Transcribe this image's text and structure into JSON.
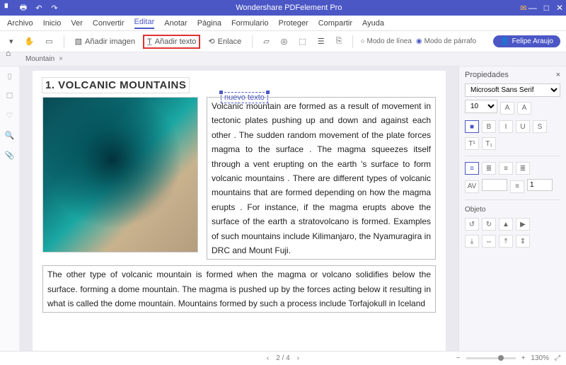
{
  "title": "Wondershare PDFelement Pro",
  "menu": {
    "items": [
      "Archivo",
      "Inicio",
      "Ver",
      "Convertir",
      "Editar",
      "Anotar",
      "Página",
      "Formulario",
      "Proteger",
      "Compartir",
      "Ayuda"
    ],
    "activeIndex": 4
  },
  "toolbar": {
    "addImage": "Añadir imagen",
    "addText": "Añadir texto",
    "link": "Enlace",
    "lineMode": "Modo de línea",
    "paraMode": "Modo de párrafo"
  },
  "user": "Felipe Araujo",
  "tab": {
    "name": "Mountain"
  },
  "doc": {
    "heading": "1. VOLCANIC MOUNTAINS",
    "newText": "nuevo texto",
    "col": "Volcanic mountain are formed as a result of movement in tectonic plates pushing up and down and against each other . The sudden random movement of the plate forces magma to the surface . The magma squeezes itself through a vent erupting on the earth 's surface to form volcanic mountains . There are different types of volcanic mountains that are formed depending on how the magma erupts . For instance, if the magma erupts above the surface of the earth a stratovolcano is formed. Examples of such mountains include Kilimanjaro, the Nyamuragira in DRC and Mount Fuji.",
    "full": "The other type of volcanic mountain is formed when the magma or volcano solidifies below the surface. forming a dome mountain. The magma is pushed up by the forces acting below it resulting in what is called the dome mountain. Mountains formed by such a process include Torfajokull in Iceland"
  },
  "props": {
    "title": "Propiedades",
    "font": "Microsoft Sans Serif",
    "size": "10",
    "B": "B",
    "I": "I",
    "U": "U",
    "S": "S",
    "objTitle": "Objeto",
    "lineSpacing": "1"
  },
  "status": {
    "page": "2 / 4",
    "zoom": "130%"
  }
}
